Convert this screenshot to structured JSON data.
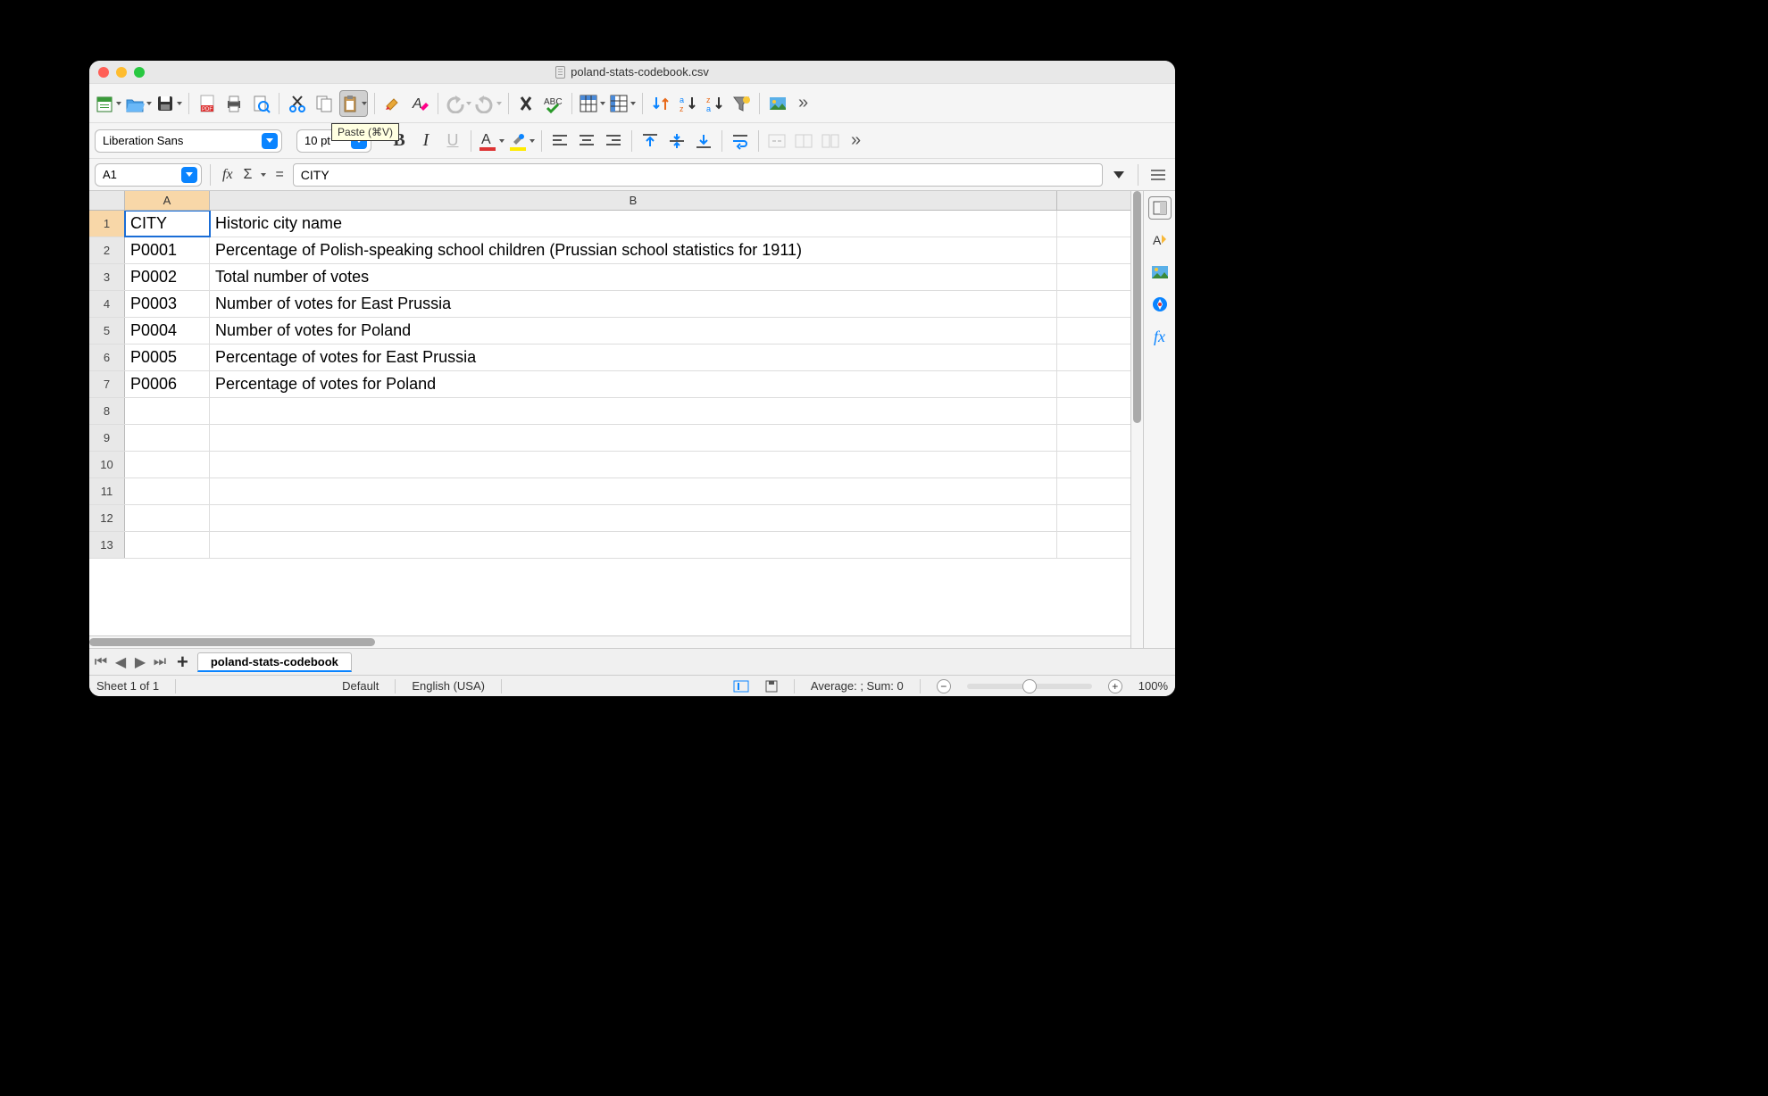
{
  "window": {
    "title": "poland-stats-codebook.csv"
  },
  "toolbar": {
    "font_name": "Liberation Sans",
    "font_size": "10 pt",
    "tooltip_paste": "Paste (⌘V)"
  },
  "formula_bar": {
    "cell_ref": "A1",
    "fx": "fx",
    "formula_value": "CITY"
  },
  "columns": {
    "A": "A",
    "B": "B"
  },
  "rows": [
    {
      "n": "1",
      "A": "CITY",
      "B": "Historic city name"
    },
    {
      "n": "2",
      "A": "P0001",
      "B": "Percentage of Polish-speaking school children (Prussian school statistics for 1911)"
    },
    {
      "n": "3",
      "A": "P0002",
      "B": "Total number of votes"
    },
    {
      "n": "4",
      "A": "P0003",
      "B": "Number of votes for East Prussia"
    },
    {
      "n": "5",
      "A": "P0004",
      "B": "Number of votes for Poland"
    },
    {
      "n": "6",
      "A": "P0005",
      "B": "Percentage of votes for East Prussia"
    },
    {
      "n": "7",
      "A": "P0006",
      "B": "Percentage of votes for Poland"
    },
    {
      "n": "8",
      "A": "",
      "B": ""
    },
    {
      "n": "9",
      "A": "",
      "B": ""
    },
    {
      "n": "10",
      "A": "",
      "B": ""
    },
    {
      "n": "11",
      "A": "",
      "B": ""
    },
    {
      "n": "12",
      "A": "",
      "B": ""
    },
    {
      "n": "13",
      "A": "",
      "B": ""
    }
  ],
  "tabs": {
    "sheet_name": "poland-stats-codebook"
  },
  "status": {
    "sheet_info": "Sheet 1 of 1",
    "style": "Default",
    "lang": "English (USA)",
    "aggregate": "Average: ; Sum: 0",
    "zoom": "100%"
  },
  "icons": {
    "sigma": "Σ",
    "equals": "="
  }
}
